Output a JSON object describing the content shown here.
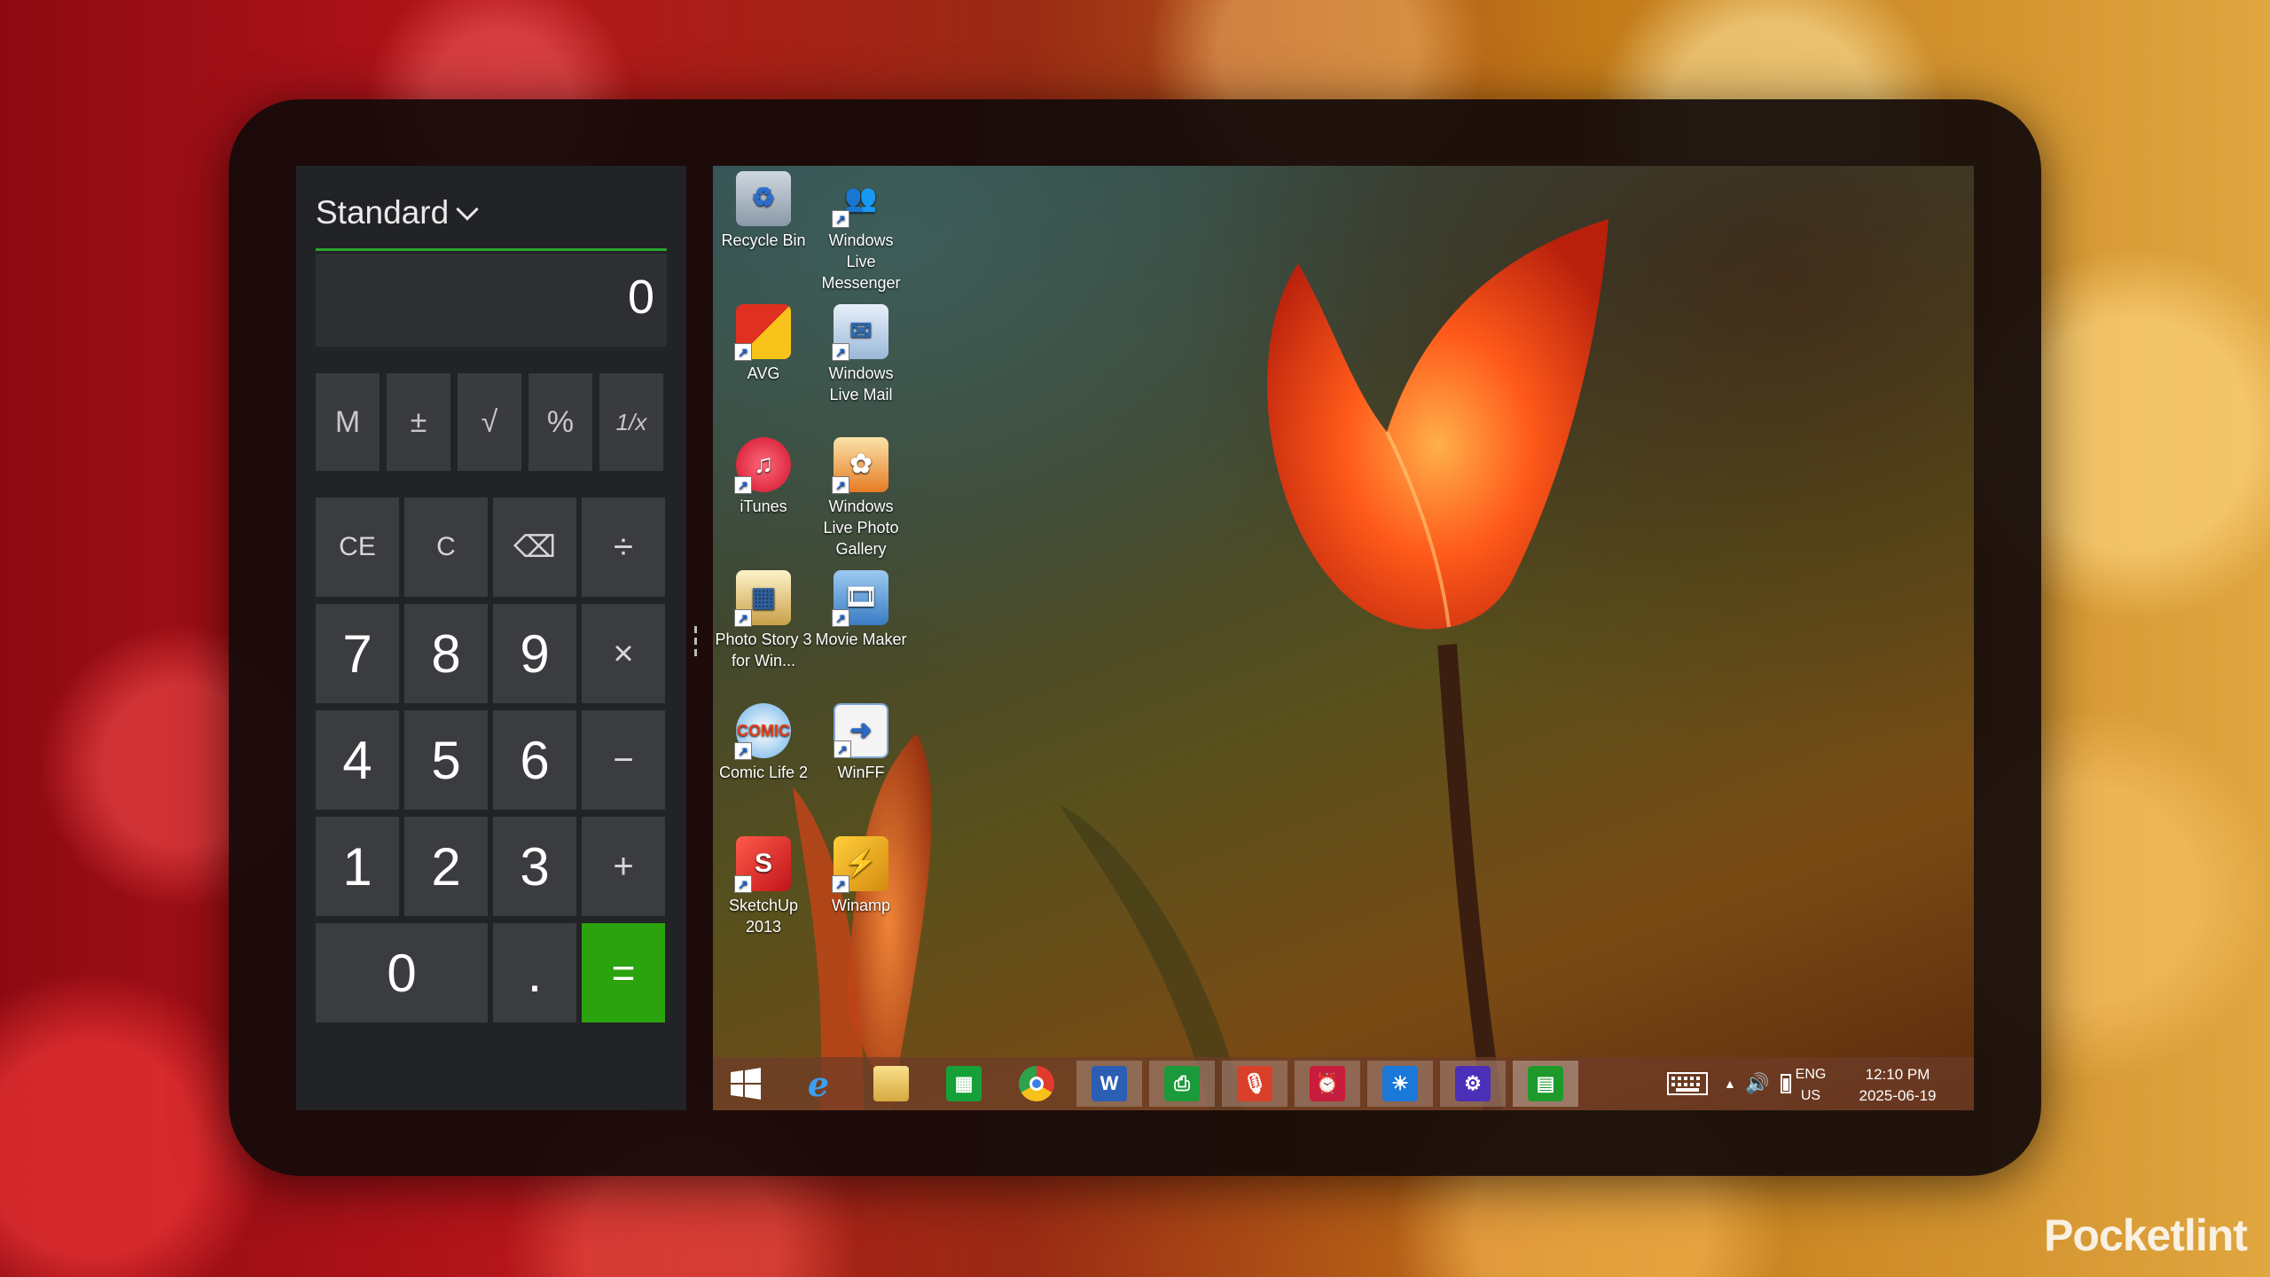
{
  "calculator": {
    "mode": "Standard",
    "display_value": "0",
    "memory_row": [
      "M",
      "±",
      "√",
      "%",
      "1/x"
    ],
    "clear_row": [
      "CE",
      "C",
      "⌫",
      "÷"
    ],
    "row7": [
      "7",
      "8",
      "9",
      "×"
    ],
    "row4": [
      "4",
      "5",
      "6",
      "−"
    ],
    "row1": [
      "1",
      "2",
      "3",
      "+"
    ],
    "row0": [
      "0",
      ".",
      "="
    ],
    "accent_color": "#2aa30f"
  },
  "desktop_icons": [
    {
      "label": "Recycle Bin",
      "icon": "recycle-bin-icon"
    },
    {
      "label": "Windows Live Messenger",
      "icon": "messenger-icon"
    },
    {
      "label": "AVG",
      "icon": "avg-icon"
    },
    {
      "label": "Windows Live Mail",
      "icon": "mail-icon"
    },
    {
      "label": "iTunes",
      "icon": "itunes-icon"
    },
    {
      "label": "Windows Live Photo Gallery",
      "icon": "photo-gallery-icon"
    },
    {
      "label": "Photo Story 3 for Win...",
      "icon": "photo-story-icon"
    },
    {
      "label": "Movie Maker",
      "icon": "movie-maker-icon"
    },
    {
      "label": "Comic Life 2",
      "icon": "comic-life-icon"
    },
    {
      "label": "WinFF",
      "icon": "winff-icon"
    },
    {
      "label": "SketchUp 2013",
      "icon": "sketchup-icon"
    },
    {
      "label": "Winamp",
      "icon": "winamp-icon"
    }
  ],
  "taskbar": {
    "pinned": [
      {
        "icon": "windows-start-icon"
      },
      {
        "icon": "internet-explorer-icon"
      },
      {
        "icon": "file-explorer-icon"
      },
      {
        "icon": "store-icon"
      },
      {
        "icon": "chrome-icon"
      },
      {
        "icon": "word-icon"
      },
      {
        "icon": "green-app-icon"
      },
      {
        "icon": "sound-recorder-icon"
      },
      {
        "icon": "alarms-icon"
      },
      {
        "icon": "weather-icon"
      },
      {
        "icon": "settings-icon"
      },
      {
        "icon": "calculator-icon"
      }
    ],
    "language_top": "ENG",
    "language_bottom": "US",
    "time": "12:10 PM",
    "date": "2025-06-19"
  },
  "watermark": "Pocketlint"
}
